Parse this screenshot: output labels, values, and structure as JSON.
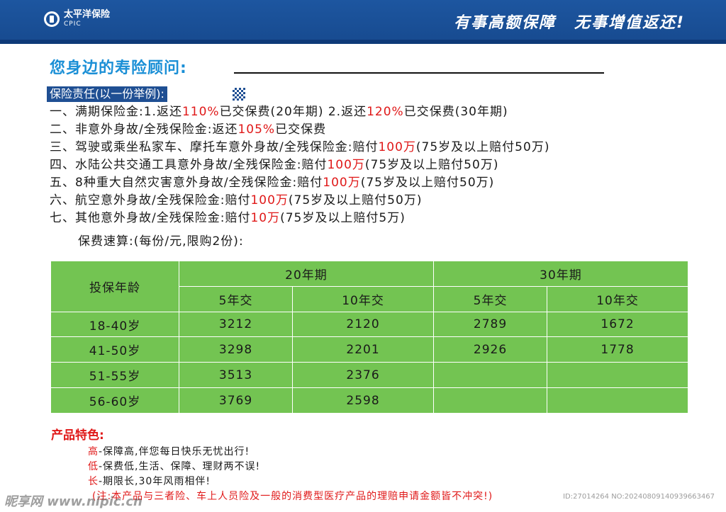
{
  "header": {
    "logo_cn": "太平洋保险",
    "logo_en": "CPIC",
    "slogan_1": "有事高额保障",
    "slogan_2": "无事增值返还!"
  },
  "advisor_label": "您身边的寿险顾问:",
  "responsibility": {
    "title": "保险责任(以一份举例):",
    "clauses": [
      {
        "a": "一、满期保险金:1.返还",
        "b": "110%",
        "c": "已交保费(20年期) 2.返还",
        "d": "120%",
        "e": "已交保费(30年期)"
      },
      {
        "a": "二、非意外身故/全残保险金:返还",
        "b": "105%",
        "c": "已交保费"
      },
      {
        "a": "三、驾驶或乘坐私家车、摩托车意外身故/全残保险金:赔付",
        "b": "100万",
        "c": "(75岁及以上赔付50万)"
      },
      {
        "a": "四、水陆公共交通工具意外身故/全残保险金:赔付",
        "b": "100万",
        "c": "(75岁及以上赔付50万)"
      },
      {
        "a": "五、8种重大自然灾害意外身故/全残保险金:赔付",
        "b": "100万",
        "c": "(75岁及以上赔付50万)"
      },
      {
        "a": "六、航空意外身故/全残保险金:赔付",
        "b": "100万",
        "c": "(75岁及以上赔付50万)"
      },
      {
        "a": "七、其他意外身故/全残保险金:赔付",
        "b": "10万",
        "c": "(75岁及以上赔付5万)"
      }
    ],
    "fee_title": "保费速算:(每份/元,限购2份):"
  },
  "fee_table": {
    "age_header": "投保年龄",
    "term_20": "20年期",
    "term_30": "30年期",
    "pay_5": "5年交",
    "pay_10": "10年交",
    "rows": [
      {
        "age": "18-40岁",
        "v1": "3212",
        "v2": "2120",
        "v3": "2789",
        "v4": "1672"
      },
      {
        "age": "41-50岁",
        "v1": "3298",
        "v2": "2201",
        "v3": "2926",
        "v4": "1778"
      },
      {
        "age": "51-55岁",
        "v1": "3513",
        "v2": "2376",
        "v3": "",
        "v4": ""
      },
      {
        "age": "56-60岁",
        "v1": "3769",
        "v2": "2598",
        "v3": "",
        "v4": ""
      }
    ]
  },
  "features": {
    "title": "产品特色:",
    "items": [
      {
        "key": "高",
        "text": "-保障高,伴您每日快乐无忧出行!"
      },
      {
        "key": "低",
        "text": "-保费低,生活、保障、理财两不误!"
      },
      {
        "key": "长",
        "text": "-期限长,30年风雨相伴!"
      }
    ],
    "note": "(注:本产品与三者险、车上人员险及一般的消费型医疗产品的理赔申请金额皆不冲突!)"
  },
  "watermark": {
    "site": "昵享网 www.nipic.cn",
    "id": "ID:27014264 NO:20240809140939663467"
  },
  "colors": {
    "brand_blue": "#1d56a0",
    "accent_red": "#e01919",
    "table_green": "#73c452",
    "title_blue": "#1a8fd6"
  }
}
